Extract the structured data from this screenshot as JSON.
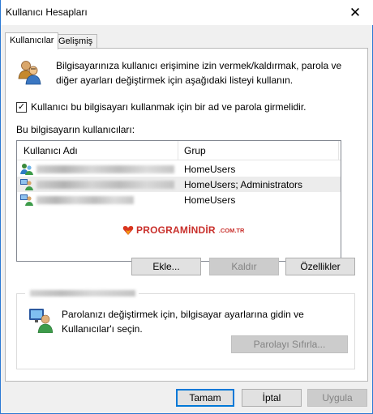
{
  "window": {
    "title": "Kullanıcı Hesapları",
    "close_symbol": "✕"
  },
  "tabs": [
    {
      "label": "Kullanıcılar",
      "active": true
    },
    {
      "label": "Gelişmiş",
      "active": false
    }
  ],
  "info": {
    "line1": "Bilgisayarınıza kullanıcı erişimine izin vermek/kaldırmak, parola ve",
    "line2": "diğer ayarları değiştirmek için aşağıdaki listeyi kullanın."
  },
  "require_login": {
    "label": "Kullanıcı bu bilgisayarı kullanmak için bir ad ve parola girmelidir.",
    "checked": true,
    "check_mark": "✓"
  },
  "users_section": {
    "heading": "Bu bilgisayarın kullanıcıları:",
    "columns": [
      "Kullanıcı Adı",
      "Grup"
    ],
    "rows": [
      {
        "group": "HomeUsers",
        "selected": false
      },
      {
        "group": "HomeUsers; Administrators",
        "selected": true
      },
      {
        "group": "HomeUsers",
        "selected": false
      }
    ]
  },
  "watermark": {
    "main": "PROGRAMİNDİR",
    "suffix": ".COM.TR"
  },
  "list_buttons": {
    "add": "Ekle...",
    "remove": "Kaldır",
    "properties": "Özellikler"
  },
  "password_group": {
    "text1": "Parolanızı değiştirmek için, bilgisayar ayarlarına gidin ve",
    "text2": "Kullanıcılar'ı seçin.",
    "reset_button": "Parolayı Sıfırla..."
  },
  "dialog_buttons": {
    "ok": "Tamam",
    "cancel": "İptal",
    "apply": "Uygula"
  },
  "colors": {
    "accent": "#0078d7",
    "watermark": "#c9302c"
  },
  "icons": [
    "users-icon",
    "user-icon",
    "admin-user-icon",
    "password-monitor-icon",
    "checkmark-icon",
    "close-icon",
    "heart-logo-icon"
  ]
}
